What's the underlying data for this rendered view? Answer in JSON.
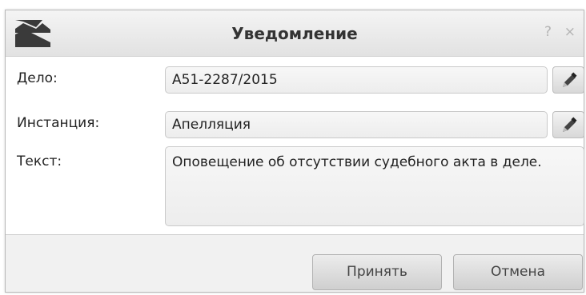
{
  "dialog": {
    "title": "Уведомление",
    "help_label": "?",
    "close_label": "×",
    "icon": "mountain-logo-icon"
  },
  "form": {
    "case": {
      "label": "Дело:",
      "value": "А51-2287/2015",
      "edit_icon": "pencil-icon"
    },
    "instance": {
      "label": "Инстанция:",
      "value": "Апелляция",
      "edit_icon": "pencil-icon"
    },
    "text": {
      "label": "Текст:",
      "value": "Оповещение об отсутствии судебного акта в деле."
    }
  },
  "footer": {
    "accept_label": "Принять",
    "cancel_label": "Отмена"
  }
}
